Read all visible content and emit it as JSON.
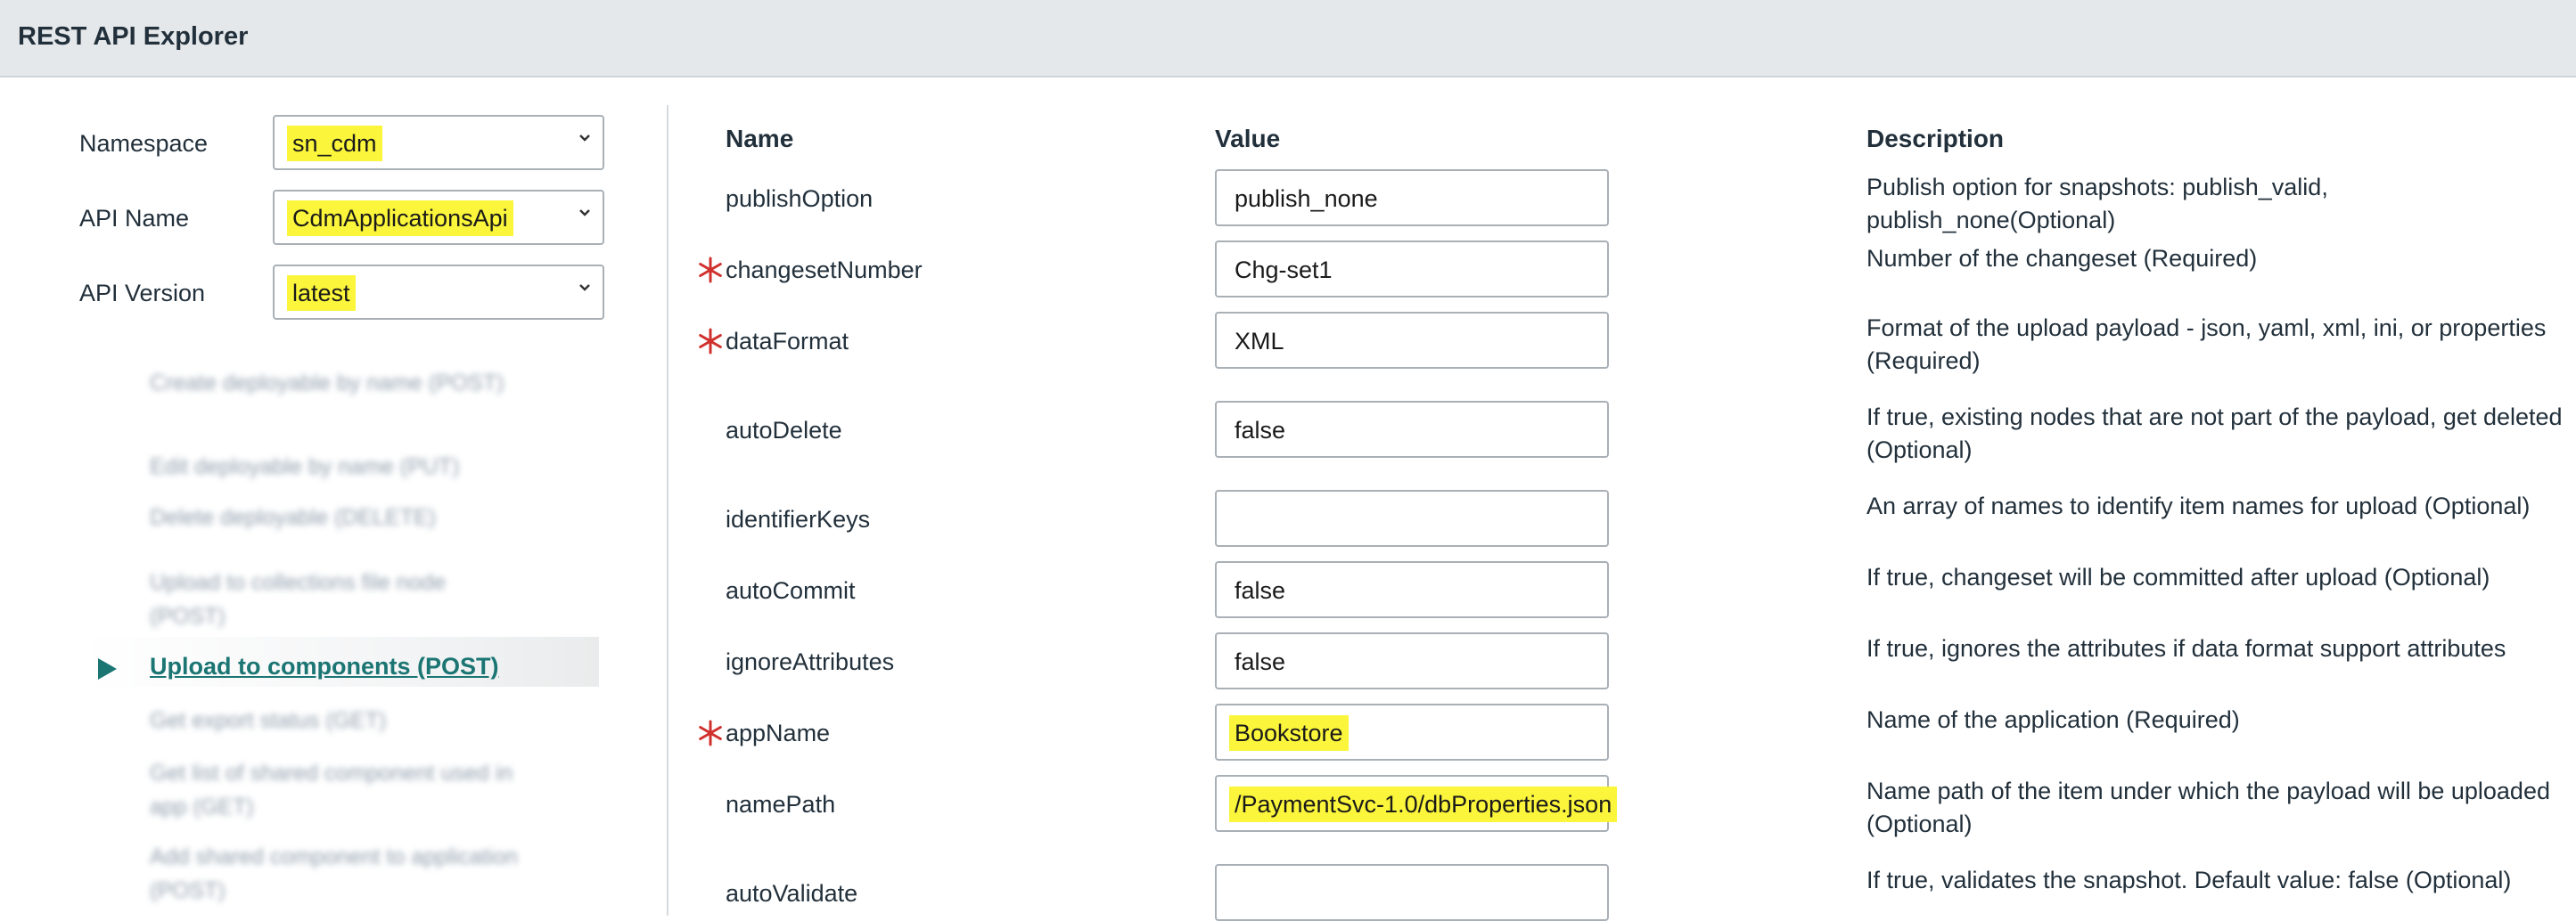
{
  "app": {
    "title": "REST API Explorer"
  },
  "sidebar": {
    "namespace_label": "Namespace",
    "namespace_value": "sn_cdm",
    "api_name_label": "API Name",
    "api_name_value": "CdmApplicationsApi",
    "api_version_label": "API Version",
    "api_version_value": "latest",
    "endpoints": [
      {
        "label": "Create deployable by name  (POST)"
      },
      {
        "label": "Edit deployable by name  (PUT)"
      },
      {
        "label": "Delete deployable  (DELETE)"
      },
      {
        "label": "Upload to collections file node  (POST)"
      },
      {
        "label": "Upload to components  (POST)",
        "active": true
      },
      {
        "label": "Get export status  (GET)"
      },
      {
        "label": "Get list of shared component used in app  (GET)"
      },
      {
        "label": "Add shared component to application  (POST)"
      }
    ]
  },
  "table": {
    "headers": {
      "name": "Name",
      "value": "Value",
      "description": "Description"
    },
    "rows": [
      {
        "name": "publishOption",
        "required": false,
        "value": "publish_none",
        "highlighted": false,
        "description": "Publish option for snapshots: publish_valid, publish_none(Optional)"
      },
      {
        "name": "changesetNumber",
        "required": true,
        "value": "Chg-set1",
        "highlighted": false,
        "description": "Number of the changeset (Required)"
      },
      {
        "name": "dataFormat",
        "required": true,
        "value": "XML",
        "highlighted": false,
        "description": "Format of the upload payload - json, yaml, xml, ini, or properties (Required)"
      },
      {
        "name": "autoDelete",
        "required": false,
        "value": "false",
        "highlighted": false,
        "description": "If true, existing nodes that are not part of the payload, get deleted (Optional)"
      },
      {
        "name": "identifierKeys",
        "required": false,
        "value": "",
        "highlighted": false,
        "description": "An array of names to identify item names for upload (Optional)"
      },
      {
        "name": "autoCommit",
        "required": false,
        "value": "false",
        "highlighted": false,
        "description": "If true, changeset will be committed after upload (Optional)"
      },
      {
        "name": "ignoreAttributes",
        "required": false,
        "value": "false",
        "highlighted": false,
        "description": "If true, ignores the attributes if data format support attributes"
      },
      {
        "name": "appName",
        "required": true,
        "value": "Bookstore",
        "highlighted": true,
        "description": "Name of the application (Required)"
      },
      {
        "name": "namePath",
        "required": false,
        "value": "/PaymentSvc-1.0/dbProperties.json",
        "highlighted": true,
        "description": "Name path of the item under which the payload will be uploaded (Optional)"
      },
      {
        "name": "autoValidate",
        "required": false,
        "value": "",
        "highlighted": false,
        "description": "If true, validates the snapshot. Default value: false (Optional)"
      }
    ]
  },
  "icons": {
    "dropdown": "chevron-down-icon",
    "required": "asterisk-icon",
    "active_endpoint": "play-arrow-icon"
  },
  "colors": {
    "highlight": "#fbf53b",
    "required": "#d0312d",
    "active_link": "#1a7573",
    "topbar": "#e5e8ea"
  }
}
